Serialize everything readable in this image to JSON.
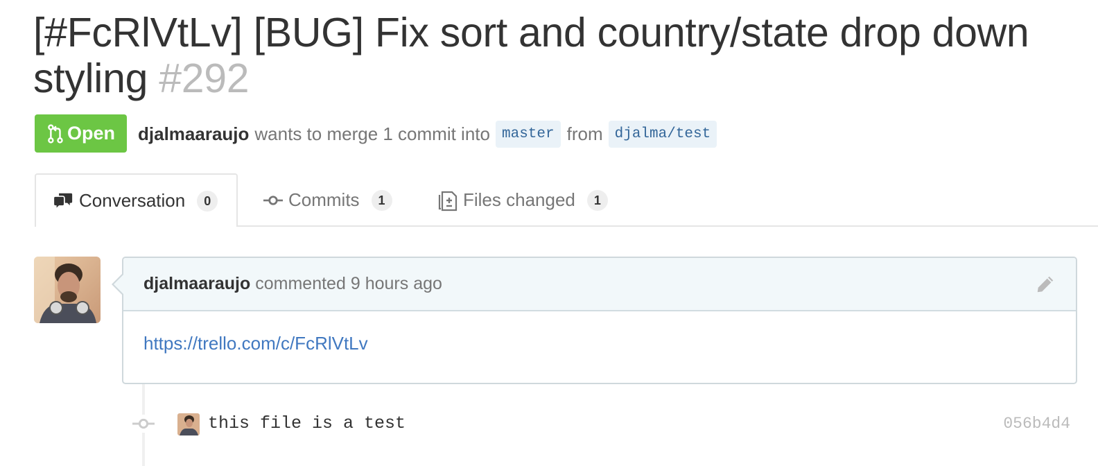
{
  "pull_request": {
    "title": "[#FcRlVtLv] [BUG] Fix sort and country/state drop down styling",
    "number": "#292",
    "state": "Open",
    "author": "djalmaaraujo",
    "merge_text": "wants to merge 1 commit into",
    "base_branch": "master",
    "from_text": "from",
    "head_branch": "djalma/test"
  },
  "tabs": [
    {
      "label": "Conversation",
      "count": "0",
      "icon": "comment-discussion-icon",
      "selected": true
    },
    {
      "label": "Commits",
      "count": "1",
      "icon": "git-commit-icon",
      "selected": false
    },
    {
      "label": "Files changed",
      "count": "1",
      "icon": "diff-icon",
      "selected": false
    }
  ],
  "comment": {
    "author": "djalmaaraujo",
    "action": "commented",
    "time": "9 hours ago",
    "body_link": "https://trello.com/c/FcRlVtLv",
    "edit_icon": "pencil-icon"
  },
  "timeline": [
    {
      "message": "this file is a test",
      "sha": "056b4d4",
      "icon": "git-commit-icon"
    }
  ],
  "colors": {
    "open_badge": "#6cc644",
    "link": "#4078c0",
    "branch_bg": "#eaf2f8",
    "comment_header_bg": "#f2f8fa",
    "muted": "#767676"
  }
}
